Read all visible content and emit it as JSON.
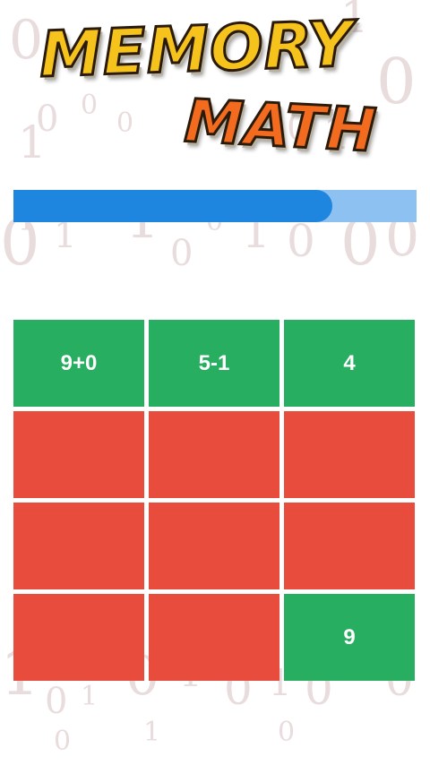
{
  "logo": {
    "line1": "MEMORY",
    "line2": "MATH"
  },
  "progress": {
    "fraction": 0.79
  },
  "colors": {
    "revealed": "#27ae60",
    "hidden": "#e74c3c",
    "progress_fill": "#1f86e0",
    "progress_track": "#8dc1f2"
  },
  "tiles": [
    {
      "state": "revealed",
      "label": "9+0"
    },
    {
      "state": "revealed",
      "label": "5-1"
    },
    {
      "state": "revealed",
      "label": "4"
    },
    {
      "state": "hidden",
      "label": ""
    },
    {
      "state": "hidden",
      "label": ""
    },
    {
      "state": "hidden",
      "label": ""
    },
    {
      "state": "hidden",
      "label": ""
    },
    {
      "state": "hidden",
      "label": ""
    },
    {
      "state": "hidden",
      "label": ""
    },
    {
      "state": "hidden",
      "label": ""
    },
    {
      "state": "hidden",
      "label": ""
    },
    {
      "state": "revealed",
      "label": "9"
    }
  ]
}
